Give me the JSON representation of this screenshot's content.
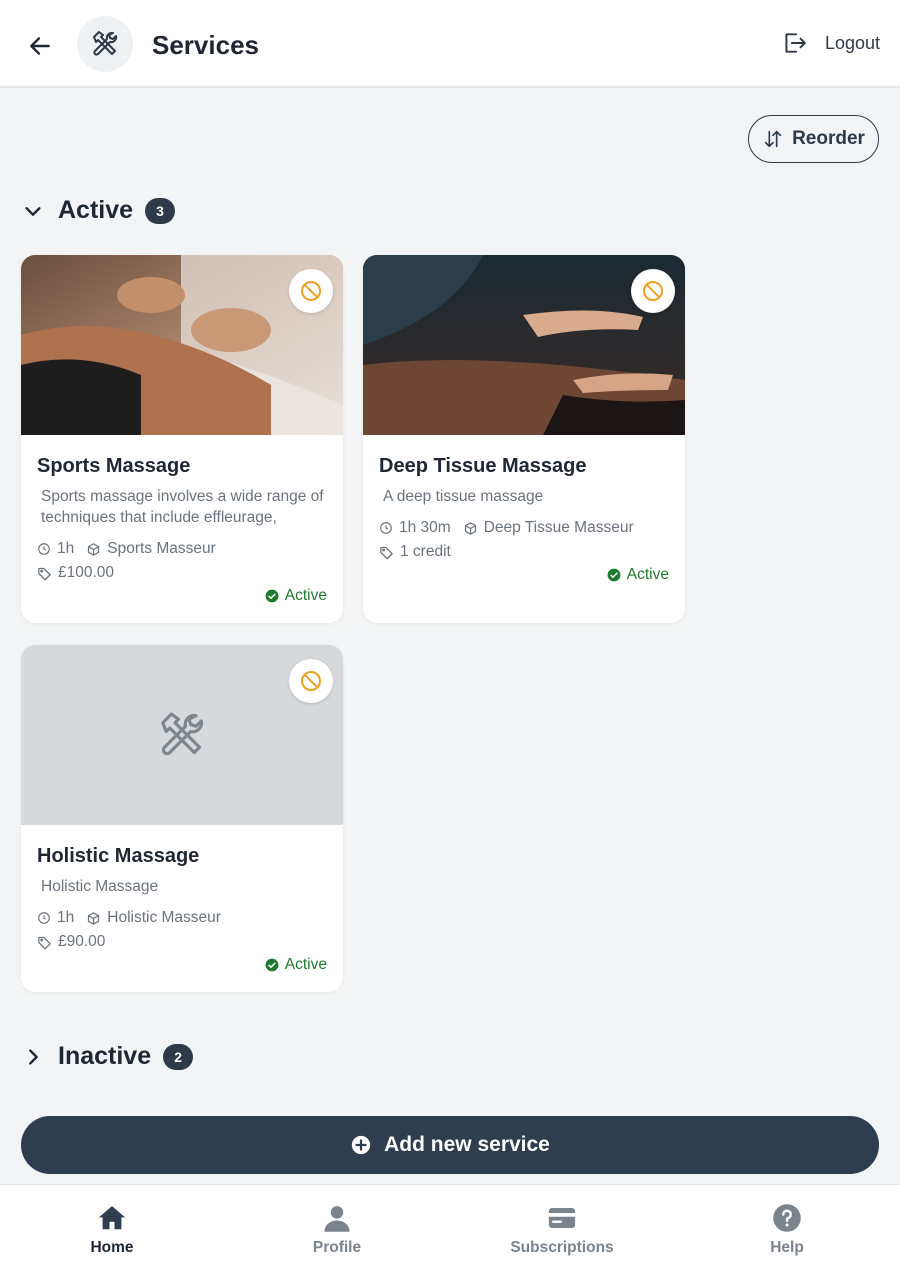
{
  "header": {
    "title": "Services",
    "logout_label": "Logout"
  },
  "toolbar": {
    "reorder_label": "Reorder"
  },
  "sections": {
    "active": {
      "title": "Active",
      "count": "3",
      "expanded": true
    },
    "inactive": {
      "title": "Inactive",
      "count": "2",
      "expanded": false
    }
  },
  "services": [
    {
      "name": "Sports Massage",
      "description": "Sports massage involves a wide range of techniques that include effleurage,",
      "duration": "1h",
      "staff": "Sports Masseur",
      "price": "£100.00",
      "status": "Active",
      "image": "massage-photo"
    },
    {
      "name": "Deep Tissue Massage",
      "description": "A deep tissue massage",
      "duration": "1h 30m",
      "staff": "Deep Tissue Masseur",
      "price": "1 credit",
      "status": "Active",
      "image": "massage-photo"
    },
    {
      "name": "Holistic Massage",
      "description": "Holistic Massage",
      "duration": "1h",
      "staff": "Holistic Masseur",
      "price": "£90.00",
      "status": "Active",
      "image": "placeholder-tools-icon"
    }
  ],
  "add_button_label": "Add new service",
  "nav": [
    {
      "label": "Home",
      "icon": "home-icon",
      "active": true
    },
    {
      "label": "Profile",
      "icon": "person-icon",
      "active": false
    },
    {
      "label": "Subscriptions",
      "icon": "card-icon",
      "active": false
    },
    {
      "label": "Help",
      "icon": "help-icon",
      "active": false
    }
  ],
  "colors": {
    "primary": "#2e3d4f",
    "status_active": "#1e7a2e",
    "disable_icon": "#f0a020",
    "background": "#f2f4f5"
  }
}
